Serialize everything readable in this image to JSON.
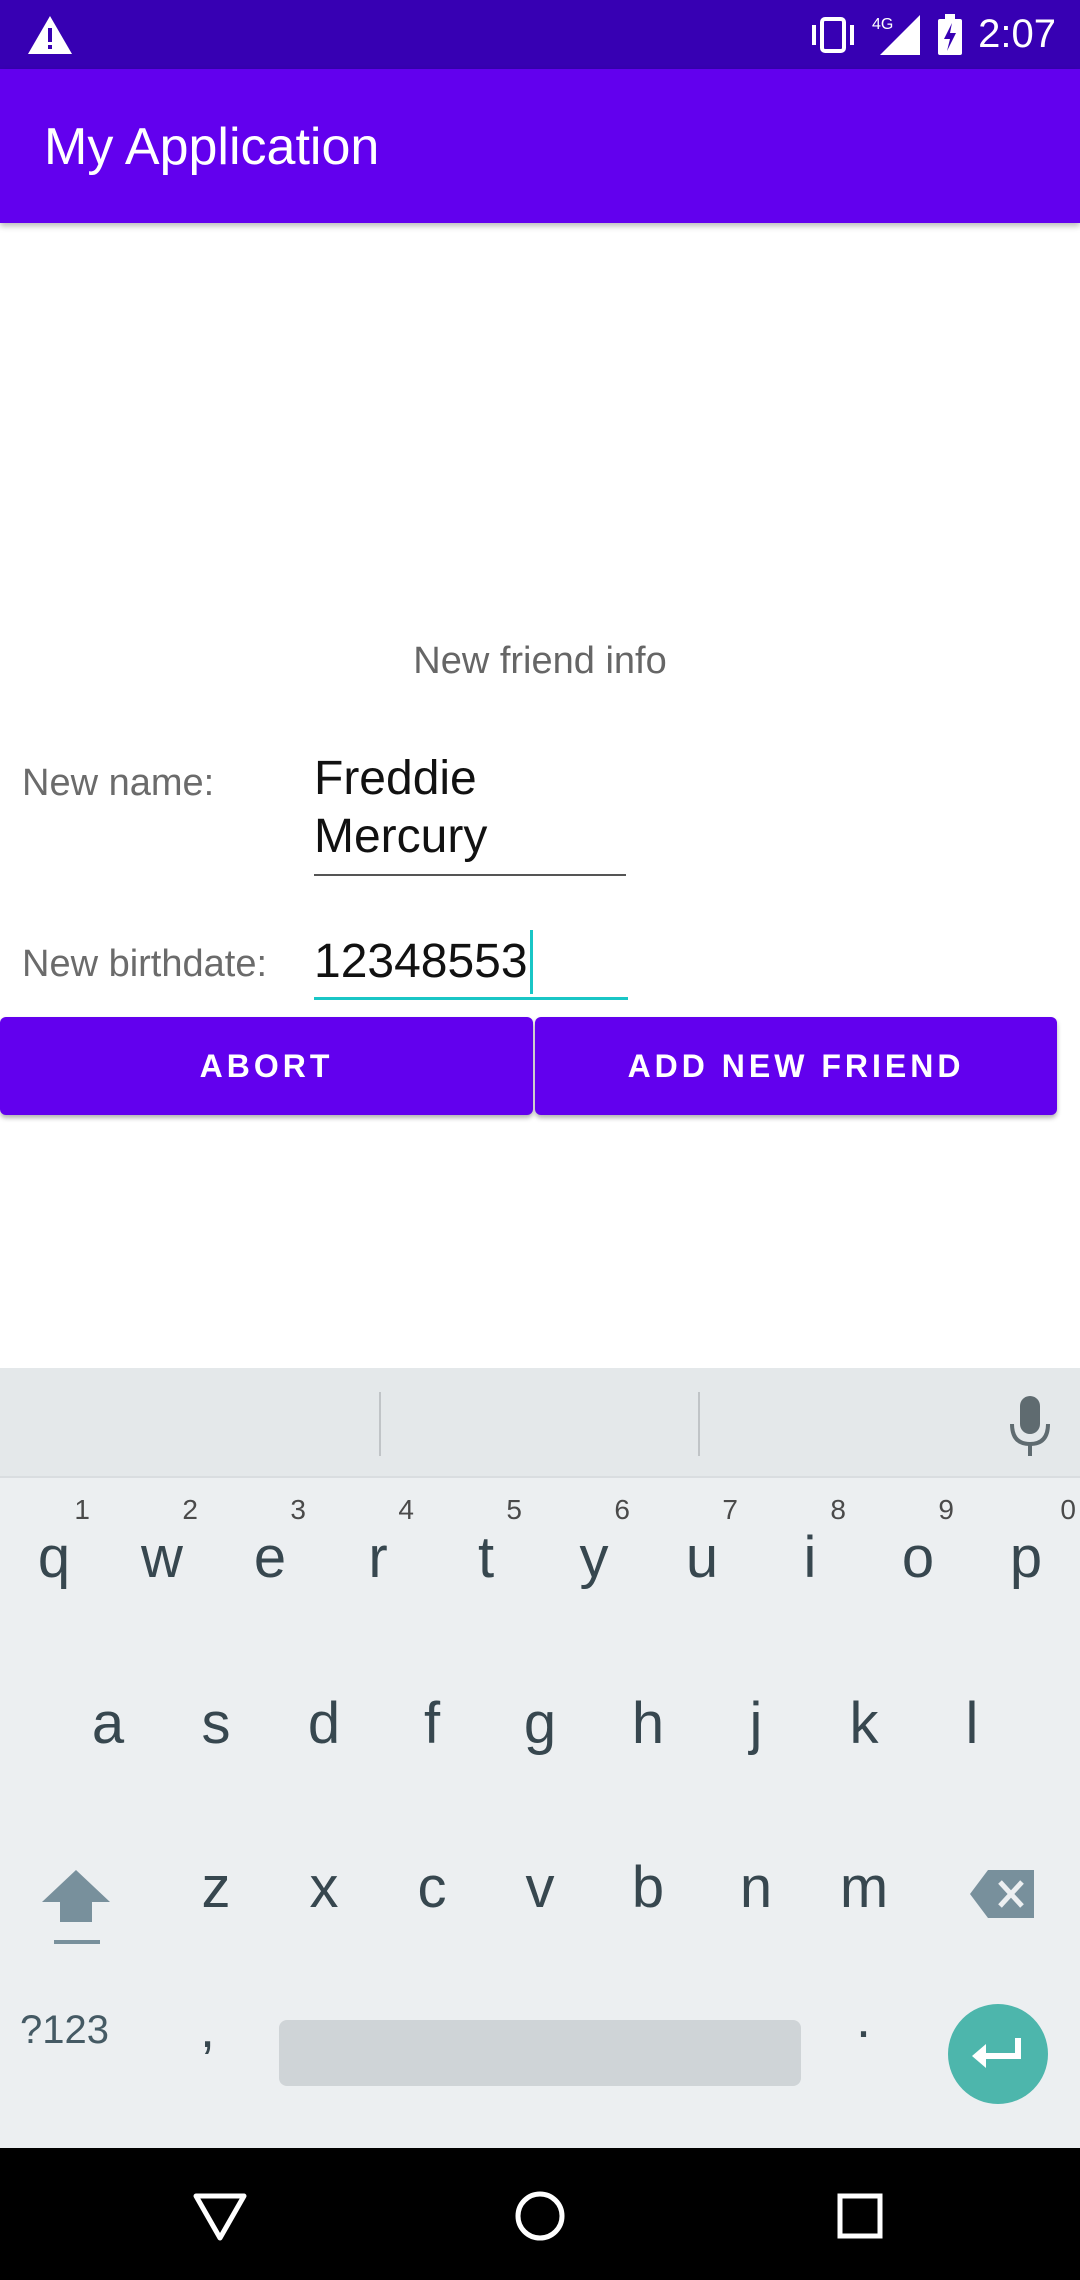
{
  "status_bar": {
    "time": "2:07",
    "network": "4G",
    "icons": [
      "warning-icon",
      "vibrate-icon",
      "signal-icon",
      "battery-charging-icon"
    ]
  },
  "app_bar": {
    "title": "My Application"
  },
  "form": {
    "heading": "New friend info",
    "name_label": "New name:",
    "name_value": "Freddie\nMercury",
    "birth_label": "New birthdate:",
    "birth_value": "12348553"
  },
  "buttons": {
    "abort": "ABORT",
    "add": "ADD NEW FRIEND"
  },
  "keyboard": {
    "row1": [
      {
        "ch": "q",
        "hint": "1"
      },
      {
        "ch": "w",
        "hint": "2"
      },
      {
        "ch": "e",
        "hint": "3"
      },
      {
        "ch": "r",
        "hint": "4"
      },
      {
        "ch": "t",
        "hint": "5"
      },
      {
        "ch": "y",
        "hint": "6"
      },
      {
        "ch": "u",
        "hint": "7"
      },
      {
        "ch": "i",
        "hint": "8"
      },
      {
        "ch": "o",
        "hint": "9"
      },
      {
        "ch": "p",
        "hint": "0"
      }
    ],
    "row2": [
      "a",
      "s",
      "d",
      "f",
      "g",
      "h",
      "j",
      "k",
      "l"
    ],
    "row3": [
      "z",
      "x",
      "c",
      "v",
      "b",
      "n",
      "m"
    ],
    "symbols": "?123",
    "comma": ",",
    "period": "."
  },
  "colors": {
    "primary": "#6200ee",
    "primary_dark": "#3700b3",
    "accent": "#19c6c6",
    "enter": "#4db6ac"
  }
}
